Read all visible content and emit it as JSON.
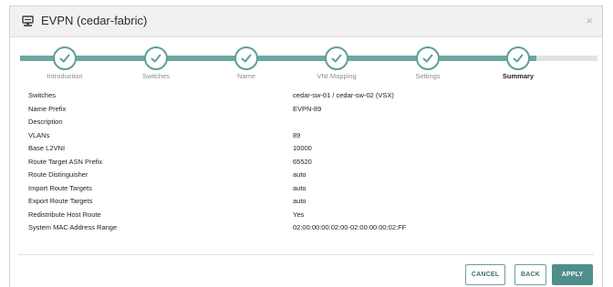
{
  "dialog": {
    "title": "EVPN (cedar-fabric)",
    "icon": "server-icon",
    "close_glyph": "×"
  },
  "wizard": {
    "steps": [
      {
        "label": "Introduction",
        "state": "complete"
      },
      {
        "label": "Switches",
        "state": "complete"
      },
      {
        "label": "Name",
        "state": "complete"
      },
      {
        "label": "VNI Mapping",
        "state": "complete"
      },
      {
        "label": "Settings",
        "state": "complete"
      },
      {
        "label": "Summary",
        "state": "current"
      }
    ],
    "accent_color": "#5f9e99"
  },
  "summary": {
    "rows": [
      {
        "label": "Switches",
        "value": "cedar-sw-01 / cedar-sw-02 (VSX)"
      },
      {
        "label": "Name Prefix",
        "value": "EVPN-89"
      },
      {
        "label": "Description",
        "value": ""
      },
      {
        "label": "VLANs",
        "value": "89"
      },
      {
        "label": "Base L2VNI",
        "value": "10000"
      },
      {
        "label": "Route Target ASN Prefix",
        "value": "65520"
      },
      {
        "label": "Route Distinguisher",
        "value": "auto"
      },
      {
        "label": "Import Route Targets",
        "value": "auto"
      },
      {
        "label": "Export Route Targets",
        "value": "auto"
      },
      {
        "label": "Redistribute Host Route",
        "value": "Yes"
      },
      {
        "label": "System MAC Address Range",
        "value": "02:00:00:00:02:00-02:00:00:00:02:FF"
      }
    ]
  },
  "footer": {
    "cancel_label": "CANCEL",
    "back_label": "BACK",
    "apply_label": "APPLY"
  }
}
